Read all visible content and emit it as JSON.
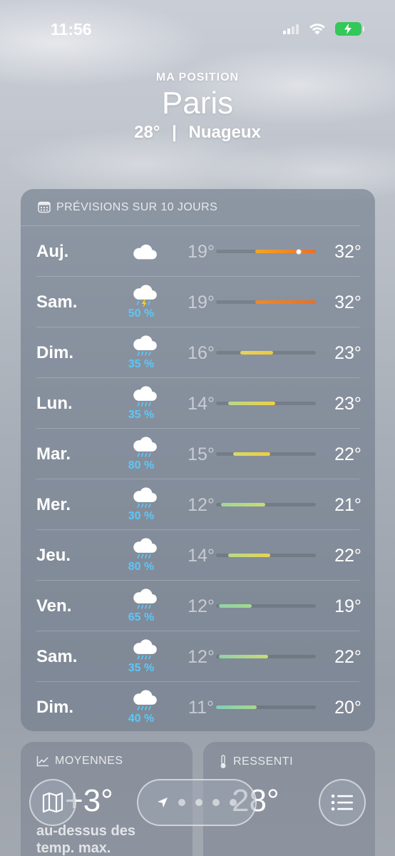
{
  "status": {
    "time": "11:56"
  },
  "header": {
    "location_label": "MA POSITION",
    "city": "Paris",
    "current_temp": "28°",
    "separator": "|",
    "condition": "Nuageux"
  },
  "forecast": {
    "title": "PRÉVISIONS SUR 10 JOURS",
    "icon": "calendar-icon",
    "days": [
      {
        "day": "Auj.",
        "icon": "cloud-icon",
        "precip": "",
        "min": "19°",
        "max": "32°",
        "range_start": 0.39,
        "range_end": 1.0,
        "current_position": 0.83,
        "bar_colors": [
          "#f5a623",
          "#e8702a"
        ]
      },
      {
        "day": "Sam.",
        "icon": "thunderstorm-icon",
        "precip": "50 %",
        "min": "19°",
        "max": "32°",
        "range_start": 0.39,
        "range_end": 1.0,
        "bar_colors": [
          "#f08a24",
          "#e8702a"
        ]
      },
      {
        "day": "Dim.",
        "icon": "rain-cloud-icon",
        "precip": "35 %",
        "min": "16°",
        "max": "23°",
        "range_start": 0.24,
        "range_end": 0.57,
        "bar_colors": [
          "#e4d35a",
          "#f0c93a"
        ]
      },
      {
        "day": "Lun.",
        "icon": "rain-cloud-icon",
        "precip": "35 %",
        "min": "14°",
        "max": "23°",
        "range_start": 0.12,
        "range_end": 0.59,
        "bar_colors": [
          "#b8d88a",
          "#f0cf40"
        ]
      },
      {
        "day": "Mar.",
        "icon": "rain-cloud-icon",
        "precip": "80 %",
        "min": "15°",
        "max": "22°",
        "range_start": 0.17,
        "range_end": 0.54,
        "bar_colors": [
          "#d6d86a",
          "#f0cd3e"
        ]
      },
      {
        "day": "Mer.",
        "icon": "rain-cloud-icon",
        "precip": "30 %",
        "min": "12°",
        "max": "21°",
        "range_start": 0.05,
        "range_end": 0.49,
        "bar_colors": [
          "#9fd69a",
          "#c9dc70"
        ]
      },
      {
        "day": "Jeu.",
        "icon": "rain-cloud-icon",
        "precip": "80 %",
        "min": "14°",
        "max": "22°",
        "range_start": 0.12,
        "range_end": 0.54,
        "bar_colors": [
          "#b8d88a",
          "#e7d452"
        ]
      },
      {
        "day": "Ven.",
        "icon": "rain-cloud-icon",
        "precip": "65 %",
        "min": "12°",
        "max": "19°",
        "range_start": 0.03,
        "range_end": 0.36,
        "bar_colors": [
          "#8fd2a8",
          "#a4d88f"
        ]
      },
      {
        "day": "Sam.",
        "icon": "rain-cloud-icon",
        "precip": "35 %",
        "min": "12°",
        "max": "22°",
        "range_start": 0.03,
        "range_end": 0.52,
        "bar_colors": [
          "#8fd2a8",
          "#c8dc72"
        ]
      },
      {
        "day": "Dim.",
        "icon": "rain-cloud-icon",
        "precip": "40 %",
        "min": "11°",
        "max": "20°",
        "range_start": 0.0,
        "range_end": 0.41,
        "bar_colors": [
          "#7fd0b8",
          "#a8d88a"
        ]
      }
    ]
  },
  "averages": {
    "title": "MOYENNES",
    "icon": "trend-chart-icon",
    "value": "+3°",
    "subtitle_line1": "au-dessus des",
    "subtitle_line2": "temp. max."
  },
  "feels_like": {
    "title": "RESSENTI",
    "icon": "thermometer-icon",
    "value": "28°"
  },
  "nav": {
    "map_icon": "map-icon",
    "location_icon": "location-arrow-icon",
    "page_count": 4,
    "list_icon": "list-icon"
  }
}
